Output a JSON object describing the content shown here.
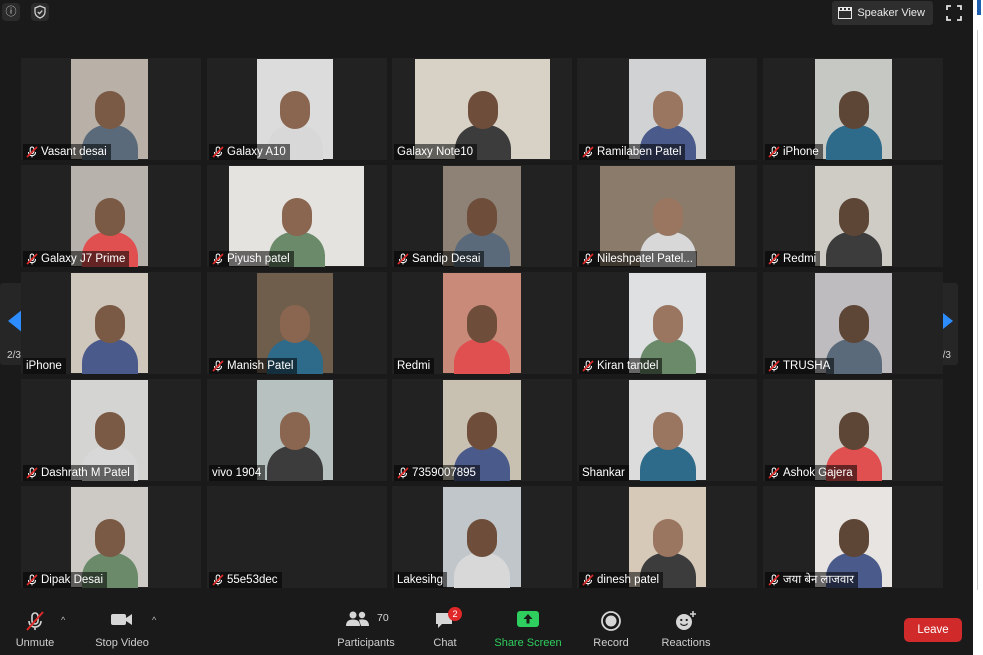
{
  "app": {
    "speaker_view_label": "Speaker View"
  },
  "pagination": {
    "left_page": "2/3",
    "right_page": "2/3"
  },
  "tiles": [
    {
      "name": "Vasant desai",
      "muted": true
    },
    {
      "name": "Galaxy A10",
      "muted": true
    },
    {
      "name": "Galaxy Note10",
      "muted": false
    },
    {
      "name": "Ramilaben Patel",
      "muted": true
    },
    {
      "name": "iPhone",
      "muted": true
    },
    {
      "name": "Galaxy J7 Prime",
      "muted": true
    },
    {
      "name": "Piyush patel",
      "muted": true
    },
    {
      "name": "Sandip Desai",
      "muted": true
    },
    {
      "name": "Nileshpatel Patel...",
      "muted": true
    },
    {
      "name": "Redmi",
      "muted": true
    },
    {
      "name": "iPhone",
      "muted": false
    },
    {
      "name": "Manish Patel",
      "muted": true
    },
    {
      "name": "Redmi",
      "muted": false
    },
    {
      "name": "Kiran tandel",
      "muted": true
    },
    {
      "name": "TRUSHA",
      "muted": true
    },
    {
      "name": "Dashrath M Patel",
      "muted": true
    },
    {
      "name": "vivo 1904",
      "muted": false
    },
    {
      "name": "7359007895",
      "muted": true
    },
    {
      "name": "Shankar",
      "muted": false
    },
    {
      "name": "Ashok Gajera",
      "muted": true
    },
    {
      "name": "Dipak Desai",
      "muted": true
    },
    {
      "name": "55e53dec",
      "muted": true
    },
    {
      "name": "Lakesihg",
      "muted": false
    },
    {
      "name": "dinesh patel",
      "muted": true
    },
    {
      "name": "जया बेन लाजवार",
      "muted": true
    }
  ],
  "toolbar": {
    "unmute": "Unmute",
    "stop_video": "Stop Video",
    "participants": "Participants",
    "participants_count": "70",
    "chat": "Chat",
    "chat_badge": "2",
    "share_screen": "Share Screen",
    "record": "Record",
    "reactions": "Reactions",
    "leave": "Leave"
  },
  "colors": {
    "share_green": "#2fcf5f",
    "leave_red": "#d12a2a",
    "nav_blue": "#2d8cff",
    "mute_red": "#e02828"
  }
}
